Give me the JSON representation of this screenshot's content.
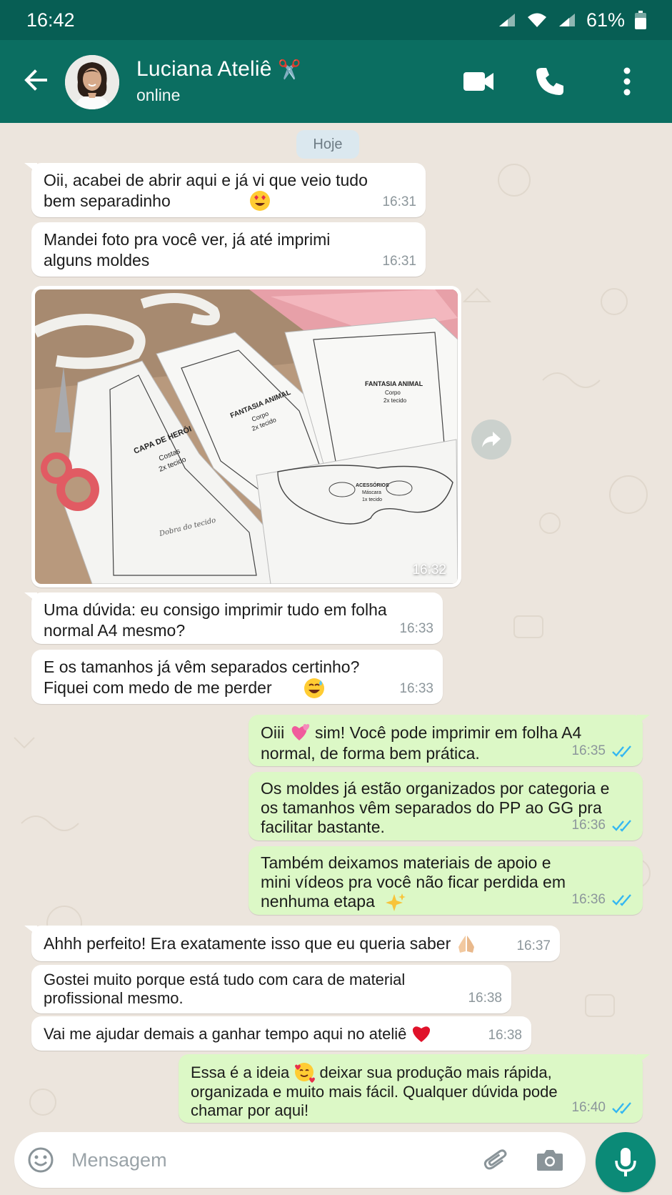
{
  "status_bar": {
    "time": "16:42",
    "battery": "61%"
  },
  "header": {
    "name": "Luciana Ateliê",
    "name_emoji": "✂️",
    "status": "online"
  },
  "date_chip": "Hoje",
  "messages": [
    {
      "id": "m1",
      "direction": "in",
      "text": "Oii, acabei de abrir aqui e já vi que veio tudo bem separadinho",
      "emoji": "😍",
      "time": "16:31"
    },
    {
      "id": "m2",
      "direction": "in",
      "text": "Mandei foto pra você ver, já até imprimi alguns moldes",
      "time": "16:31"
    },
    {
      "id": "m3",
      "direction": "in",
      "type": "image",
      "time": "16:32",
      "image_labels": {
        "cape": [
          "CAPA DE HERÓI",
          "Costas",
          "2x tecido"
        ],
        "body1": [
          "FANTASIA ANIMAL",
          "Corpo",
          "2x tecido"
        ],
        "body2": [
          "FANTASIA ANIMAL",
          "Corpo",
          "2x tecido"
        ],
        "mask": [
          "ACESSÓRIOS",
          "Máscara",
          "1x tecido"
        ],
        "fold": "Dobra do tecido"
      }
    },
    {
      "id": "m4",
      "direction": "in",
      "text": "Uma dúvida: eu consigo imprimir tudo em folha normal A4 mesmo?",
      "time": "16:33"
    },
    {
      "id": "m5",
      "direction": "in",
      "text": "E os tamanhos já vêm separados certinho? Fiquei com medo de me perder",
      "emoji": "😅",
      "time": "16:33"
    },
    {
      "id": "m6",
      "direction": "out",
      "text_before": "Oiii",
      "emoji": "💕",
      "text": "sim! Você pode imprimir em folha A4 normal, de forma bem prática.",
      "time": "16:35",
      "status": "read"
    },
    {
      "id": "m7",
      "direction": "out",
      "text": "Os moldes já estão organizados por categoria e os tamanhos vêm separados do PP ao GG pra facilitar bastante.",
      "time": "16:36",
      "status": "read"
    },
    {
      "id": "m8",
      "direction": "out",
      "text": "Também deixamos materiais de apoio e mini vídeos pra você não ficar perdida em nenhuma etapa",
      "emoji": "✨",
      "time": "16:36",
      "status": "read"
    },
    {
      "id": "m9",
      "direction": "in",
      "text": "Ahhh perfeito! Era exatamente isso que eu queria saber",
      "emoji": "🙏",
      "time": "16:37"
    },
    {
      "id": "m10",
      "direction": "in",
      "text": "Gostei muito porque está tudo com cara de material profissional mesmo.",
      "time": "16:38"
    },
    {
      "id": "m11",
      "direction": "in",
      "text": "Vai me ajudar demais a ganhar tempo aqui no ateliê",
      "emoji": "❤️",
      "time": "16:38"
    },
    {
      "id": "m12",
      "direction": "out",
      "text_before": "Essa é a ideia",
      "emoji": "🥰",
      "text": "deixar sua produção mais rápida, organizada e muito mais fácil. Qualquer dúvida pode chamar por aqui!",
      "time": "16:40",
      "status": "read"
    }
  ],
  "composer": {
    "placeholder": "Mensagem"
  },
  "colors": {
    "header": "#0b6e61",
    "status_bar": "#075e54",
    "outgoing_bubble": "#dcf8c6",
    "incoming_bubble": "#ffffff",
    "chat_background": "#ece5dd",
    "read_ticks": "#34b7f1",
    "mic_button": "#0b8a77"
  }
}
